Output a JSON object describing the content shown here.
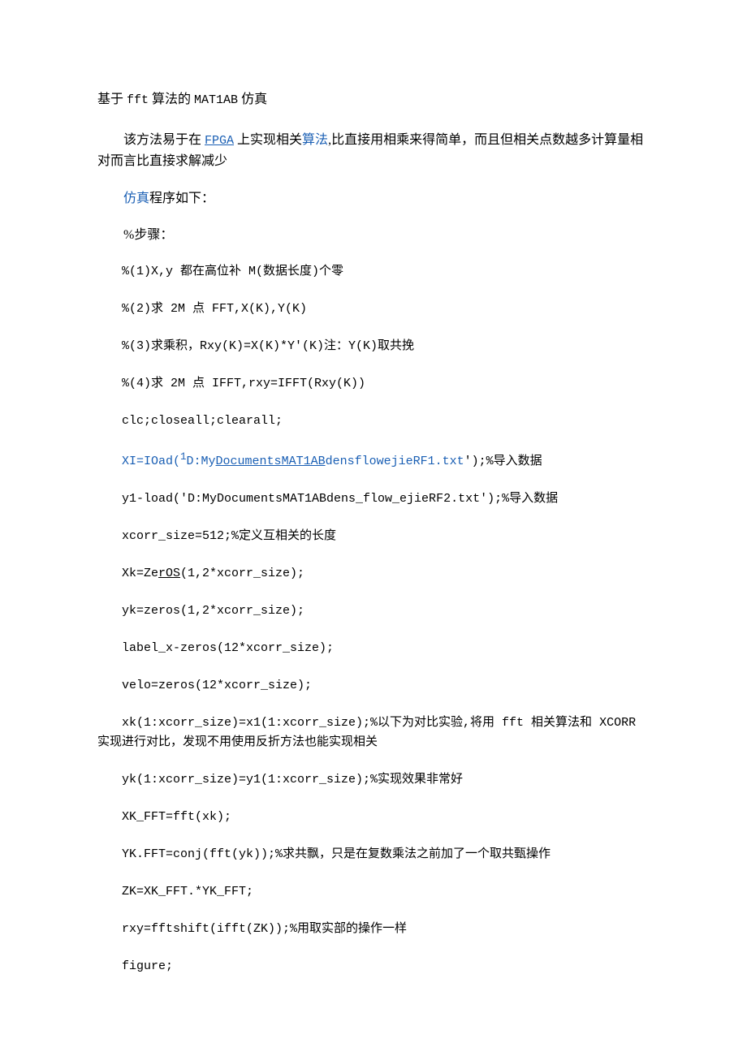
{
  "title_prefix": "基于 ",
  "title_fft": "fft",
  "title_mid": " 算法的 ",
  "title_matlab": "MAT1AB",
  "title_suffix": " 仿真",
  "intro_1": "该方法易于在 ",
  "intro_fpga": "FPGA",
  "intro_2": " 上实现相关",
  "intro_algo": "算法",
  "intro_3": ",比直接用相乘来得简单，而且但相关点数越多计算量相对而言比直接求解减少",
  "sim_label": "仿真",
  "sim_suffix": "程序如下：",
  "step_label": "%步骤：",
  "step1": "%(1)X,y 都在高位补 M(数据长度)个零",
  "step2": "%(2)求 2M 点 FFT,X(K),Y(K)",
  "step3": "%(3)求乘积，Rxy(K)=X(K)*Y'(K)注：Y(K)取共挽",
  "step4": "%(4)求 2M 点 IFFT,rxy=IFFT(Rxy(K))",
  "clc": "clc;closeall;clearall;",
  "load1_a": "XI=IOad(",
  "load1_b": "1",
  "load1_c": "D:My",
  "load1_d": "Documents",
  "load1_e": "MAT1AB",
  "load1_f": "densflowejieRF1.txt",
  "load1_g": "'",
  "load1_h": ");%导入数据",
  "load2": "y1-load('D:MyDocumentsMAT1ABdens_flow_ejieRF2.txt');%导入数据",
  "xcorr_size": "xcorr_size=512;%定义互相关的长度",
  "xk_a": "Xk=Ze",
  "xk_b": "rOS",
  "xk_c": "(1,2*xcorr_size);",
  "yk": "yk=zeros(1,2*xcorr_size);",
  "labelx": "label_x-zeros(12*xcorr_size);",
  "velo": "velo=zeros(12*xcorr_size);",
  "assign1": "xk(1:xcorr_size)=x1(1:xcorr_size);%以下为对比实验,将用 fft 相关算法和 XCORR 实现进行对比，发现不用使用反折方法也能实现相关",
  "assign2": "yk(1:xcorr_size)=y1(1:xcorr_size);%实现效果非常好",
  "xkfft": "XK_FFT=fft(xk);",
  "ykfft": "YK.FFT=conj(fft(yk));%求共飘，只是在复数乘法之前加了一个取共甄操作",
  "zk": "ZK=XK_FFT.*YK_FFT;",
  "rxy": "rxy=fftshift(ifft(ZK));%用取实部的操作一样",
  "figure": "figure;"
}
